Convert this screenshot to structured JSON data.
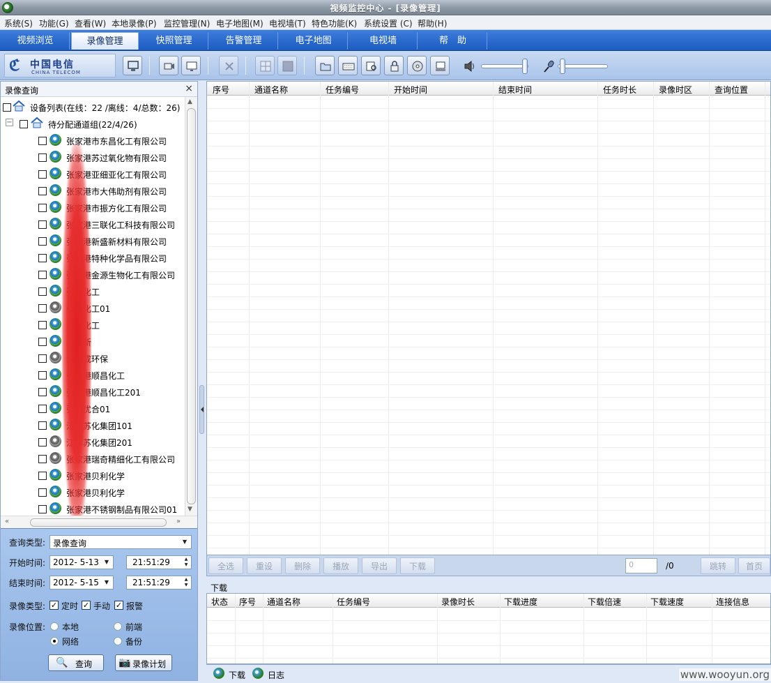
{
  "window": {
    "title": "视频监控中心 - [录像管理]"
  },
  "menu": [
    "系统(S)",
    "功能(G)",
    "查看(W)",
    "本地录像(P)",
    "监控管理(N)",
    "电子地图(M)",
    "电视墙(T)",
    "特色功能(K)",
    "系统设置 (C)",
    "帮助(H)"
  ],
  "tabs": [
    "视频浏览",
    "录像管理",
    "快照管理",
    "告警管理",
    "电子地图",
    "电视墙",
    "帮　助"
  ],
  "logo": {
    "cn": "中国电信",
    "en": "CHINA TELECOM"
  },
  "left_panel": {
    "title": "录像查询",
    "close": "×",
    "root": "设备列表(在线：22 /离线：4/总数：26)",
    "group": "待分配通道组(22/4/26)",
    "devices": [
      {
        "label": "张家港市东昌化工有限公司",
        "status": "online"
      },
      {
        "label": "张家港苏过氧化物有限公司",
        "status": "online"
      },
      {
        "label": "张家港亚细亚化工有限公司",
        "status": "online"
      },
      {
        "label": "张家港市大伟助剂有限公司",
        "status": "online"
      },
      {
        "label": "张家港市振方化工有限公司",
        "status": "online"
      },
      {
        "label": "张家港三联化工科技有限公司",
        "status": "online"
      },
      {
        "label": "张家港新盛新材料有限公司",
        "status": "online"
      },
      {
        "label": "张家港特种化学品有限公司",
        "status": "online"
      },
      {
        "label": "张家港金源生物化工有限公司",
        "status": "online"
      },
      {
        "label": "张家化工",
        "status": "online"
      },
      {
        "label": "张家化工01",
        "status": "offline"
      },
      {
        "label": "张家化工",
        "status": "online"
      },
      {
        "label": "亚细新",
        "status": "online"
      },
      {
        "label": "澳合成环保",
        "status": "offline"
      },
      {
        "label": "张家港顺昌化工",
        "status": "online"
      },
      {
        "label": "张家港顺昌化工201",
        "status": "online"
      },
      {
        "label": "张家优合01",
        "status": "online"
      },
      {
        "label": "江苏苏化集团101",
        "status": "online"
      },
      {
        "label": "江苏苏化集团201",
        "status": "offline"
      },
      {
        "label": "张家港瑞奇精细化工有限公司",
        "status": "offline"
      },
      {
        "label": "张家港贝利化学",
        "status": "online"
      },
      {
        "label": "张家港贝利化学",
        "status": "online"
      },
      {
        "label": "张家港不锈钢制品有限公司01",
        "status": "online"
      }
    ]
  },
  "query": {
    "type_label": "查询类型:",
    "type_value": "录像查询",
    "start_label": "开始时间:",
    "start_date": "2012- 5-13",
    "start_time": "21:51:29",
    "end_label": "结束时间:",
    "end_date": "2012- 5-15",
    "end_time": "21:51:29",
    "rec_type_label": "录像类型:",
    "rec_types": [
      "定时",
      "手动",
      "报警"
    ],
    "location_label": "录像位置:",
    "locations": [
      "本地",
      "前端",
      "网络",
      "备份"
    ],
    "selected_location": "网络",
    "search_btn": "查询",
    "plan_btn": "录像计划"
  },
  "grid": {
    "columns": [
      "序号",
      "通道名称",
      "任务编号",
      "开始时间",
      "结束时间",
      "任务时长",
      "录像时区",
      "查询位置"
    ]
  },
  "pager": {
    "buttons": [
      "全选",
      "重设",
      "删除",
      "播放",
      "导出",
      "下载"
    ],
    "page_input": "0",
    "total": "/0",
    "jump": "跳转",
    "first": "首页"
  },
  "download": {
    "title": "下载",
    "columns": [
      "状态",
      "序号",
      "通道名称",
      "任务编号",
      "录像时长",
      "下载进度",
      "下载倍速",
      "下载速度",
      "连接信息"
    ]
  },
  "bottom_tabs": [
    "下载",
    "日志"
  ],
  "watermark": "www.wooyun.org"
}
